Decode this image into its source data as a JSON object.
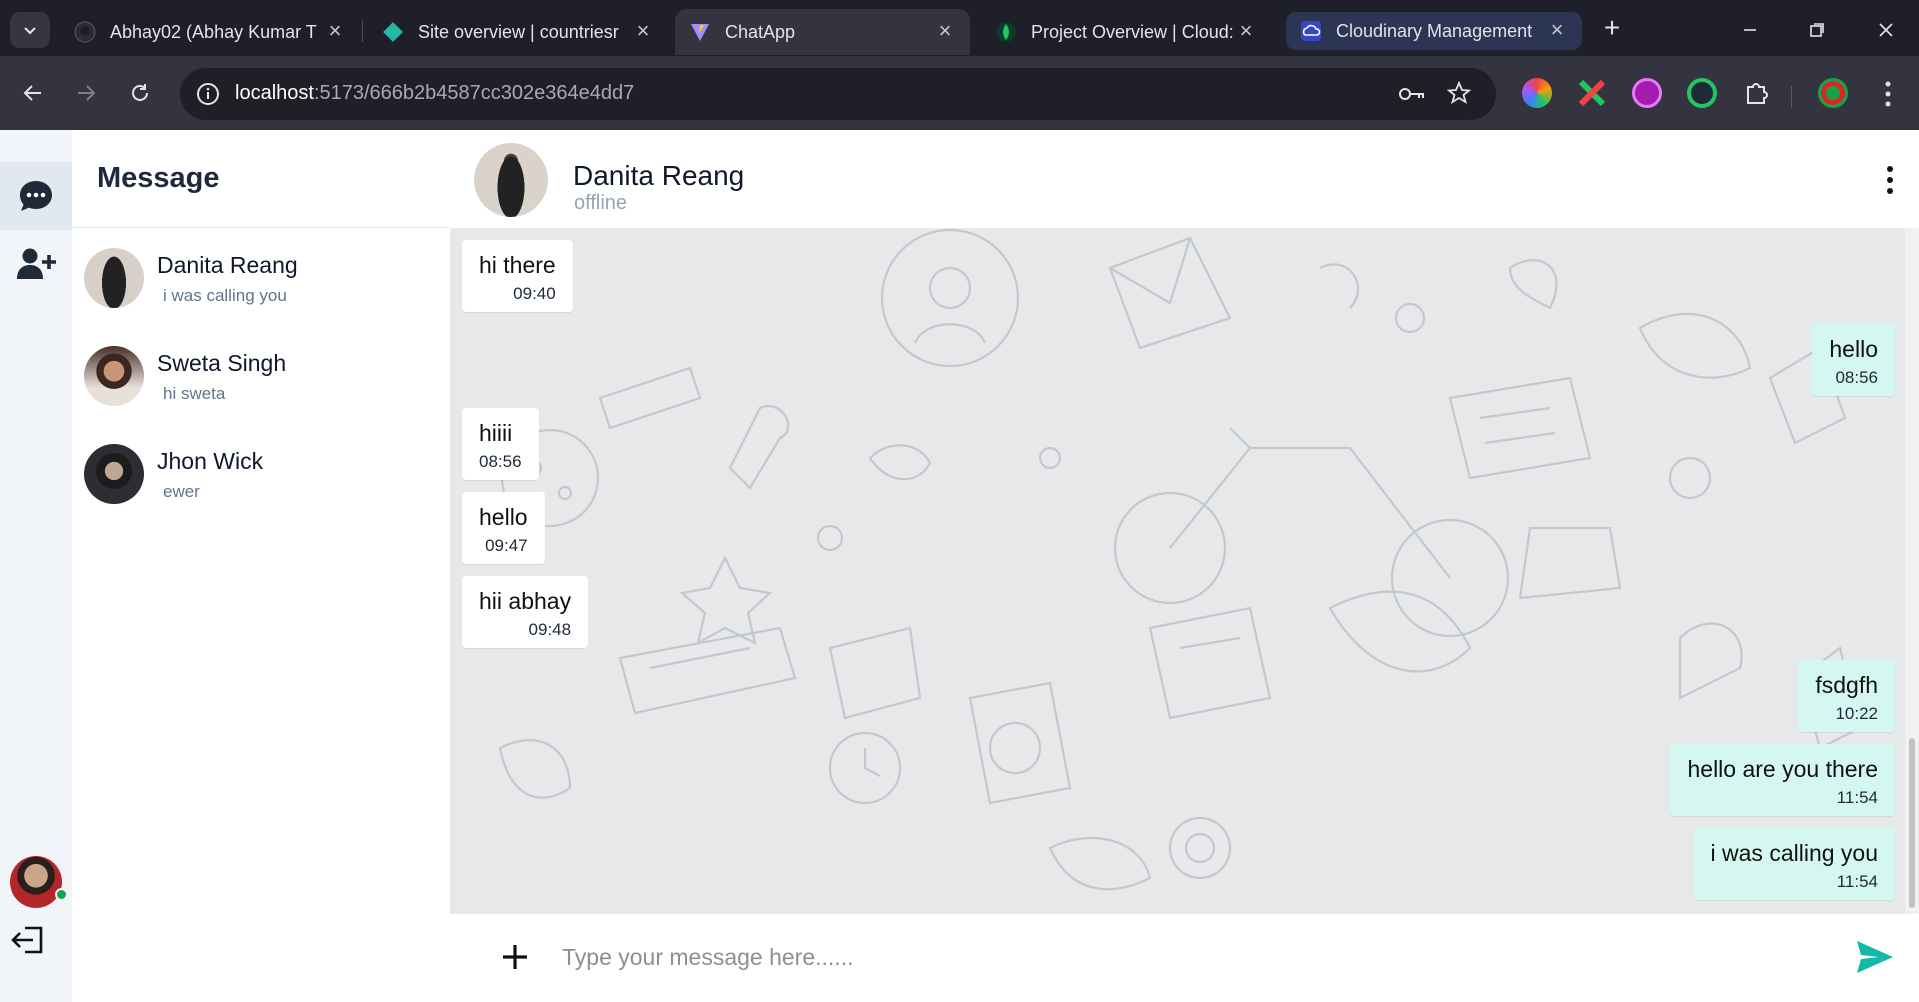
{
  "browser": {
    "tabs": [
      {
        "title": "Abhay02 (Abhay Kumar T",
        "icon": "github-icon"
      },
      {
        "title": "Site overview | countriesr",
        "icon": "netlify-icon"
      },
      {
        "title": "ChatApp",
        "icon": "vite-icon",
        "active": true
      },
      {
        "title": "Project Overview | Cloud:",
        "icon": "mongodb-icon"
      },
      {
        "title": "Cloudinary Management",
        "icon": "cloudinary-icon"
      }
    ],
    "url_host": "localhost",
    "url_path": ":5173/666b2b4587cc302e364e4dd7"
  },
  "sidebar": {
    "title": "Message",
    "contacts": [
      {
        "name": "Danita Reang",
        "last": "i was calling you"
      },
      {
        "name": "Sweta Singh",
        "last": "hi sweta"
      },
      {
        "name": "Jhon Wick",
        "last": "ewer"
      }
    ]
  },
  "chat": {
    "name": "Danita Reang",
    "status": "offline",
    "messages": [
      {
        "text": "hi there",
        "time": "09:40",
        "dir": "in"
      },
      {
        "text": "hello",
        "time": "08:56",
        "dir": "out"
      },
      {
        "text": "hiiii",
        "time": "08:56",
        "dir": "in"
      },
      {
        "text": "hello",
        "time": "09:47",
        "dir": "in"
      },
      {
        "text": "hii abhay",
        "time": "09:48",
        "dir": "in"
      },
      {
        "text": "fsdgfh",
        "time": "10:22",
        "dir": "out"
      },
      {
        "text": "hello are you there",
        "time": "11:54",
        "dir": "out"
      },
      {
        "text": "i was calling you",
        "time": "11:54",
        "dir": "out"
      }
    ],
    "input_placeholder": "Type your message here......"
  },
  "colors": {
    "outgoing_bubble": "#d4f8ef",
    "incoming_bubble": "#ffffff",
    "send_icon": "#14b8a6",
    "online": "#16a34a"
  }
}
